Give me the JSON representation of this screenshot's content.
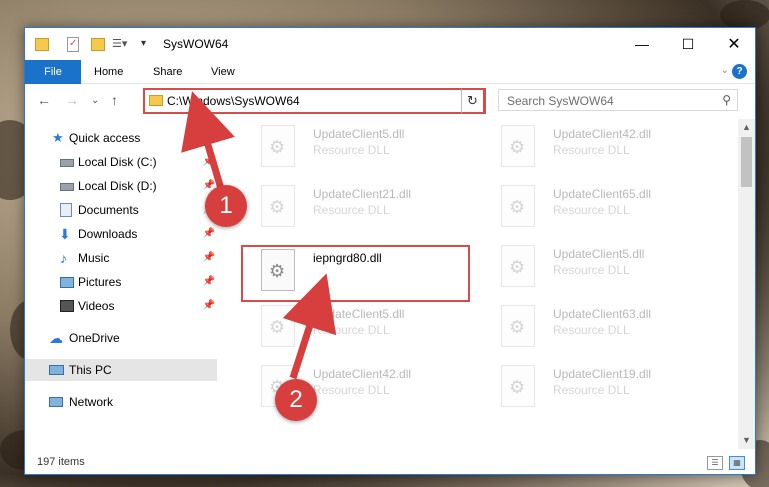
{
  "window": {
    "title": "SysWOW64"
  },
  "ribbon": {
    "tabs": [
      "File",
      "Home",
      "Share",
      "View"
    ],
    "help_label": "?"
  },
  "address": {
    "path": "C:\\Windows\\SysWOW64"
  },
  "search": {
    "placeholder": "Search SysWOW64"
  },
  "sidebar": {
    "items": [
      {
        "label": "Quick access",
        "icon": "star-icon",
        "pinned": false
      },
      {
        "label": "Local Disk (C:)",
        "icon": "drive-icon",
        "pinned": true
      },
      {
        "label": "Local Disk (D:)",
        "icon": "drive-icon",
        "pinned": true
      },
      {
        "label": "Documents",
        "icon": "documents-icon",
        "pinned": true
      },
      {
        "label": "Downloads",
        "icon": "download-icon",
        "pinned": true
      },
      {
        "label": "Music",
        "icon": "music-icon",
        "pinned": true
      },
      {
        "label": "Pictures",
        "icon": "pictures-icon",
        "pinned": true
      },
      {
        "label": "Videos",
        "icon": "videos-icon",
        "pinned": true
      },
      {
        "label": "OneDrive",
        "icon": "cloud-icon",
        "pinned": false
      },
      {
        "label": "This PC",
        "icon": "computer-icon",
        "pinned": false,
        "selected": true
      },
      {
        "label": "Network",
        "icon": "network-icon",
        "pinned": false
      }
    ]
  },
  "files": {
    "left": [
      {
        "name": "UpdateClient5.dll",
        "type": "Resource DLL"
      },
      {
        "name": "UpdateClient21.dll",
        "type": "Resource DLL"
      },
      {
        "name": "iepngrd80.dll",
        "type": ""
      },
      {
        "name": "UpdateClient5.dll",
        "type": "Resource DLL"
      },
      {
        "name": "UpdateClient42.dll",
        "type": "Resource DLL"
      }
    ],
    "right": [
      {
        "name": "UpdateClient42.dll",
        "type": "Resource DLL"
      },
      {
        "name": "UpdateClient65.dll",
        "type": "Resource DLL"
      },
      {
        "name": "UpdateClient5.dll",
        "type": "Resource DLL"
      },
      {
        "name": "UpdateClient63.dll",
        "type": "Resource DLL"
      },
      {
        "name": "UpdateClient19.dll",
        "type": "Resource DLL"
      }
    ]
  },
  "status": {
    "item_count": "197 items"
  },
  "annotations": {
    "step1": "1",
    "step2": "2",
    "color": "#d73e3e"
  }
}
